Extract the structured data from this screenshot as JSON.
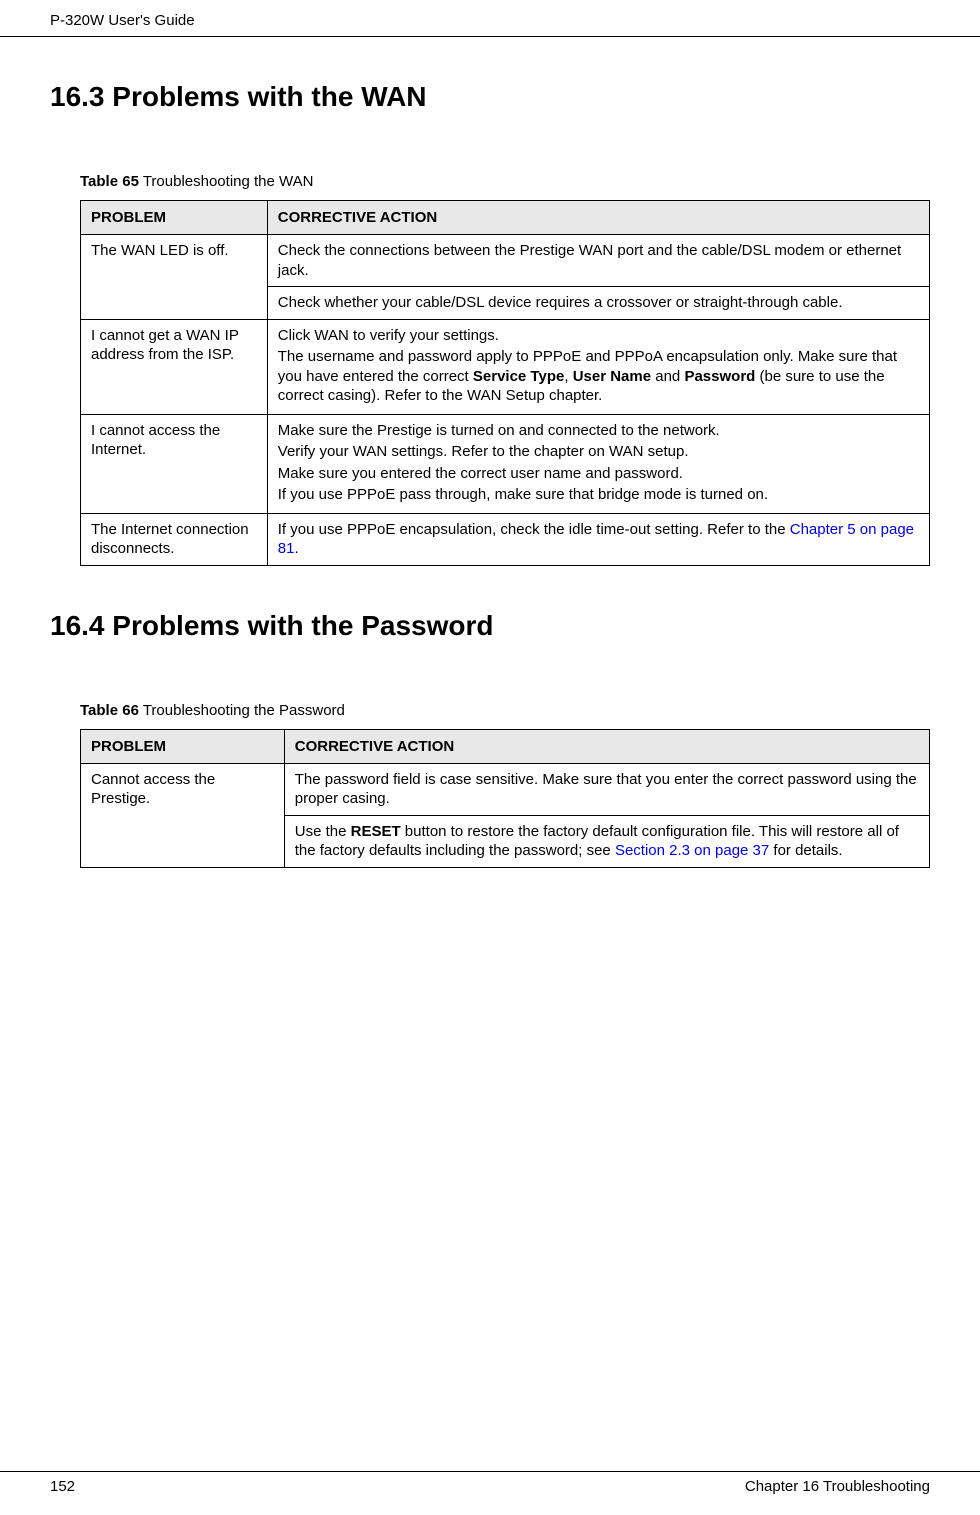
{
  "header": {
    "title": "P-320W User's Guide"
  },
  "sections": {
    "wan": {
      "heading": "16.3  Problems with the WAN",
      "table_caption_bold": "Table 65",
      "table_caption_rest": "   Troubleshooting the WAN",
      "col_problem": "PROBLEM",
      "col_action": "CORRECTIVE ACTION",
      "rows": {
        "r1_problem": "The WAN LED is off.",
        "r1a_action": "Check the connections between the Prestige WAN port and the cable/DSL modem or ethernet jack.",
        "r1b_action": "Check whether your cable/DSL device requires a crossover or straight-through cable.",
        "r2_problem": "I cannot get a WAN IP address from the ISP.",
        "r2_action_p1": "Click WAN to verify your settings.",
        "r2_action_p2_a": "The username and password apply to PPPoE and PPPoA encapsulation only. Make sure that you have entered the correct ",
        "r2_action_p2_b1": "Service Type",
        "r2_action_p2_c": ", ",
        "r2_action_p2_b2": "User Name",
        "r2_action_p2_d": " and ",
        "r2_action_p2_b3": "Password",
        "r2_action_p2_e": " (be sure to use the correct casing). Refer to the WAN Setup chapter.",
        "r3_problem": "I cannot access the Internet.",
        "r3_action_p1": "Make sure the Prestige is turned on and connected to the network.",
        "r3_action_p2": "Verify your WAN settings. Refer to the chapter on WAN setup.",
        "r3_action_p3": "Make sure you entered the correct user name and password.",
        "r3_action_p4": "If you use PPPoE pass through, make sure that bridge mode is turned on.",
        "r4_problem": "The Internet connection disconnects.",
        "r4_action_a": "If you use PPPoE encapsulation, check the idle time-out setting. Refer to the ",
        "r4_action_link": "Chapter 5 on page 81",
        "r4_action_b": "."
      }
    },
    "password": {
      "heading": "16.4  Problems with the Password",
      "table_caption_bold": "Table 66",
      "table_caption_rest": "   Troubleshooting the Password",
      "col_problem": "PROBLEM",
      "col_action": "CORRECTIVE ACTION",
      "rows": {
        "r1_problem": "Cannot access the Prestige.",
        "r1a_action": "The password field is case sensitive. Make sure that you enter the correct password using the proper casing.",
        "r1b_action_a": "Use the ",
        "r1b_action_b": "RESET",
        "r1b_action_c": " button to restore the factory default configuration file. This will restore all of the factory defaults including the password; see ",
        "r1b_action_link": "Section 2.3 on page 37",
        "r1b_action_d": " for details."
      }
    }
  },
  "footer": {
    "page_number": "152",
    "chapter": "Chapter 16 Troubleshooting"
  }
}
